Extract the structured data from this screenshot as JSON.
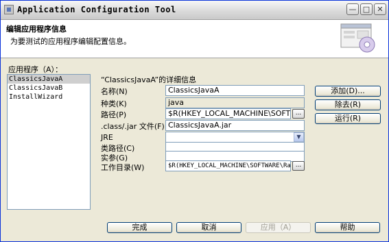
{
  "window": {
    "title": "Application Configuration Tool",
    "controls": {
      "minimize": "—",
      "maximize": "□",
      "close": "✕"
    }
  },
  "header": {
    "title": "编辑应用程序信息",
    "description": "为要测试的应用程序编辑配置信息。",
    "graphic_icon": "configure-window-icon"
  },
  "apps": {
    "label": "应用程序（A）：",
    "items": [
      "ClassicsJavaA",
      "ClassicsJavaB",
      "InstallWizard"
    ],
    "selected": "ClassicsJavaA"
  },
  "details": {
    "heading": "“ClassicsJavaA”的详细信息",
    "name_label": "名称(N)",
    "name_value": "ClassicsJavaA",
    "kind_label": "种类(K)",
    "kind_value": "java",
    "path_label": "路径(P)",
    "path_value": "$R(HKEY_LOCAL_MACHINE\\SOFTWARE\\",
    "browse_label": "...",
    "jar_label": ".class/.jar 文件(F)",
    "jar_value": "ClassicsJavaA.jar",
    "jre_label": "JRE",
    "jre_value": "",
    "classpath_label": "类路径(C)",
    "classpath_value": "",
    "args_label": "实参(G)",
    "args_value": "",
    "workdir_label": "工作目录(W)",
    "workdir_value": "$R(HKEY_LOCAL_MACHINE\\SOFTWARE\\Rati"
  },
  "side_buttons": {
    "add": "添加(D)...",
    "remove": "除去(R)",
    "run": "运行(R)"
  },
  "footer_buttons": {
    "finish": "完成",
    "cancel": "取消",
    "apply": "应用（A）",
    "help": "帮助"
  },
  "colors": {
    "window_border": "#0831d9",
    "dialog_bg": "#ece9d8",
    "selection": "#cfcfcf"
  }
}
